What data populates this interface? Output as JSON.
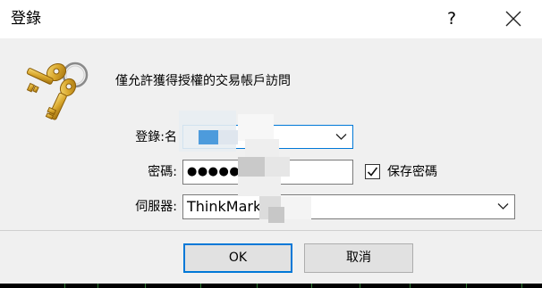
{
  "window": {
    "title": "登錄",
    "help_label": "?",
    "close_icon": "close-icon"
  },
  "intro": {
    "text": "僅允許獲得授權的交易帳戶訪問",
    "icon": "keys-icon"
  },
  "form": {
    "login_label": "登錄:名",
    "login_value": "",
    "password_label": "密碼:",
    "password_value": "●●●●●●",
    "save_password_label": "保存密碼",
    "save_password_checked": true,
    "server_label": "伺服器:",
    "server_value": "ThinkMarke"
  },
  "buttons": {
    "ok_label": "OK",
    "cancel_label": "取消"
  },
  "colors": {
    "focus_border": "#0078d7",
    "button_face": "#e1e1e1",
    "dialog_bg": "#f0f0f0"
  }
}
